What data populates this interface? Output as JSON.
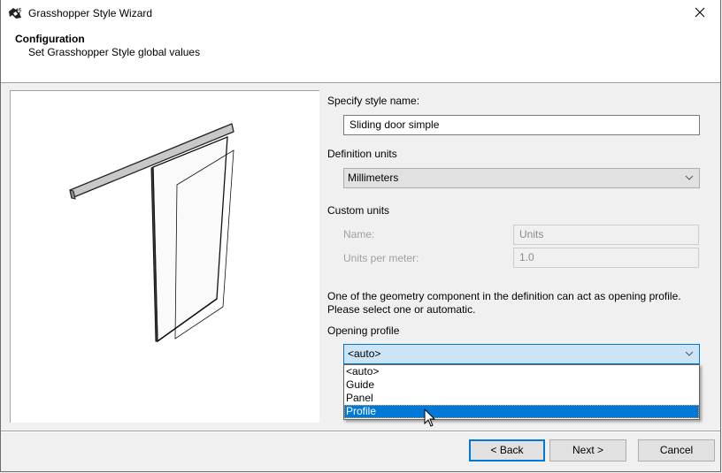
{
  "window": {
    "title": "Grasshopper Style Wizard",
    "app_icon": "grasshopper-rhino-icon",
    "close_icon": "close-icon"
  },
  "header": {
    "title": "Configuration",
    "subtitle": "Set Grasshopper Style global values"
  },
  "preview": {
    "description": "sliding door simple 3D preview"
  },
  "form": {
    "style_name_label": "Specify style name:",
    "style_name_value": "Sliding door simple",
    "definition_units_label": "Definition units",
    "definition_units_value": "Millimeters",
    "custom_units_label": "Custom units",
    "custom_name_label": "Name:",
    "custom_name_value": "Units",
    "units_per_meter_label": "Units per meter:",
    "units_per_meter_value": "1.0",
    "info_line1": "One of the geometry component in the definition can act as opening profile.",
    "info_line2": "Please select one or automatic.",
    "opening_profile_label": "Opening profile",
    "opening_profile_value": "<auto>",
    "opening_profile_options": [
      "<auto>",
      "Guide",
      "Panel",
      "Profile"
    ],
    "opening_profile_highlighted": "Profile"
  },
  "buttons": {
    "back": "< Back",
    "next": "Next >",
    "cancel": "Cancel"
  },
  "colors": {
    "accent": "#0078d7",
    "highlight_bg": "#cce4f7"
  }
}
